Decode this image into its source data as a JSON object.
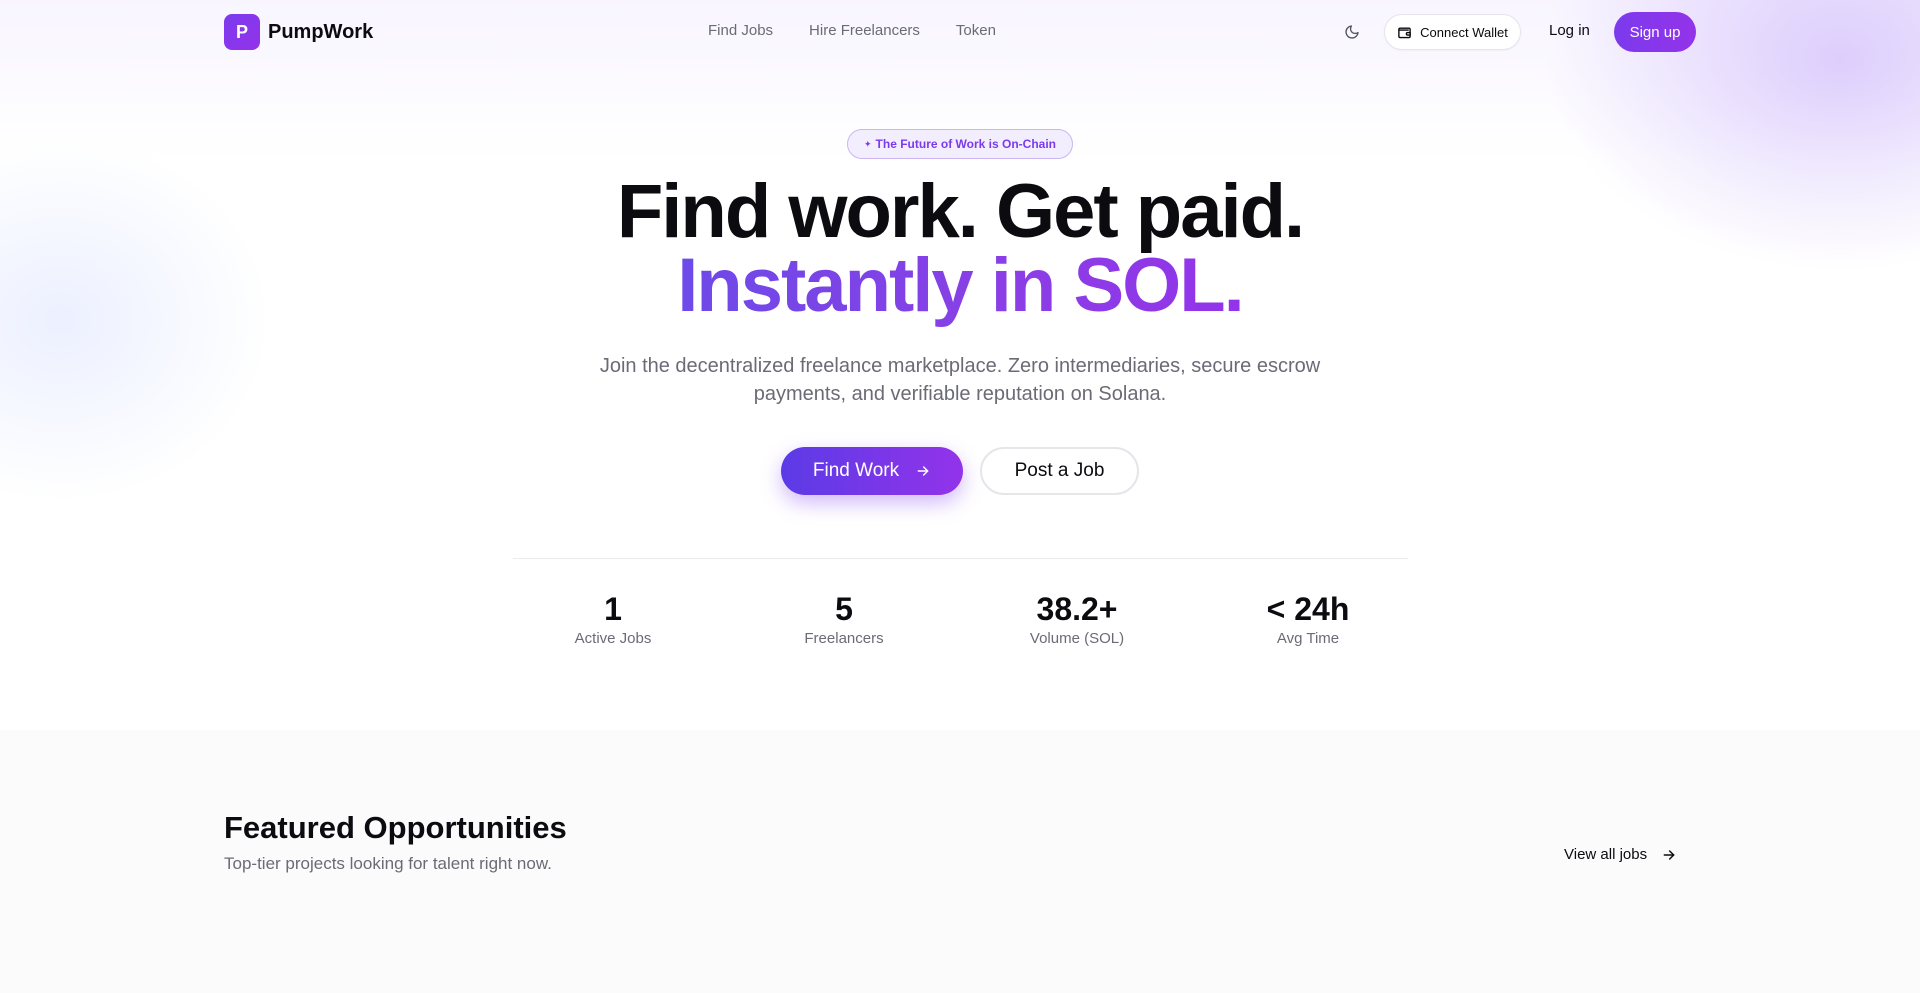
{
  "brand": {
    "logo_letter": "P",
    "name": "PumpWork"
  },
  "nav": {
    "links": [
      {
        "label": "Find Jobs"
      },
      {
        "label": "Hire Freelancers"
      },
      {
        "label": "Token"
      }
    ],
    "theme_icon": "moon-icon",
    "wallet_label": "Connect Wallet",
    "wallet_icon": "wallet-icon",
    "login_label": "Log in",
    "signup_label": "Sign up"
  },
  "hero": {
    "badge": "The Future of Work is On-Chain",
    "badge_icon": "sparkle-icon",
    "title_line1": "Find work. Get paid.",
    "title_line2": "Instantly in SOL.",
    "subtitle": "Join the decentralized freelance marketplace. Zero intermediaries, secure escrow payments, and verifiable reputation on Solana.",
    "primary_cta": "Find Work",
    "secondary_cta": "Post a Job"
  },
  "stats": [
    {
      "value": "1",
      "label": "Active Jobs"
    },
    {
      "value": "5",
      "label": "Freelancers"
    },
    {
      "value": "38.2+",
      "label": "Volume (SOL)"
    },
    {
      "value": "< 24h",
      "label": "Avg Time"
    }
  ],
  "featured": {
    "title": "Featured Opportunities",
    "subtitle": "Top-tier projects looking for talent right now.",
    "view_all": "View all jobs"
  },
  "colors": {
    "accent": "#7c3aed",
    "accent_gradient_end": "#9333ea",
    "muted_text": "#6b6b76"
  }
}
